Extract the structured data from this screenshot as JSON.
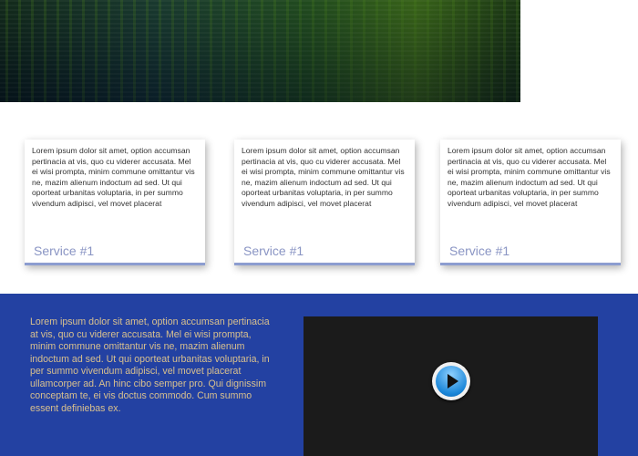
{
  "services": [
    {
      "text": "Lorem ipsum dolor sit amet, option accumsan pertinacia at vis, quo cu viderer accusata. Mel ei wisi prompta, minim commune omittantur vis ne, mazim alienum indoctum ad sed. Ut qui oporteat urbanitas voluptaria, in per summo vivendum adipisci, vel movet placerat",
      "title": "Service #1"
    },
    {
      "text": "Lorem ipsum dolor sit amet, option accumsan pertinacia at vis, quo cu viderer accusata. Mel ei wisi prompta, minim commune omittantur vis ne, mazim alienum indoctum ad sed. Ut qui oporteat urbanitas voluptaria, in per summo vivendum adipisci, vel movet placerat",
      "title": "Service #1"
    },
    {
      "text": "Lorem ipsum dolor sit amet, option accumsan pertinacia at vis, quo cu viderer accusata. Mel ei wisi prompta, minim commune omittantur vis ne, mazim alienum indoctum ad sed. Ut qui oporteat urbanitas voluptaria, in per summo vivendum adipisci, vel movet placerat",
      "title": "Service #1"
    }
  ],
  "feature": {
    "text": "Lorem ipsum dolor sit amet, option accumsan pertinacia at vis, quo cu viderer accusata. Mel ei wisi prompta, minim commune omittantur vis ne, mazim alienum indoctum ad sed. Ut qui oporteat urbanitas voluptaria, in per summo vivendum adipisci, vel movet placerat ullamcorper ad. An hinc cibo semper pro. Qui dignissim conceptam te, ei vis doctus commodo. Cum summo essent definiebas ex.",
    "video_icon": "play-icon"
  },
  "colors": {
    "band": "#2341a2",
    "feature_text": "#d8c08e",
    "service_title": "#8a95c4"
  }
}
